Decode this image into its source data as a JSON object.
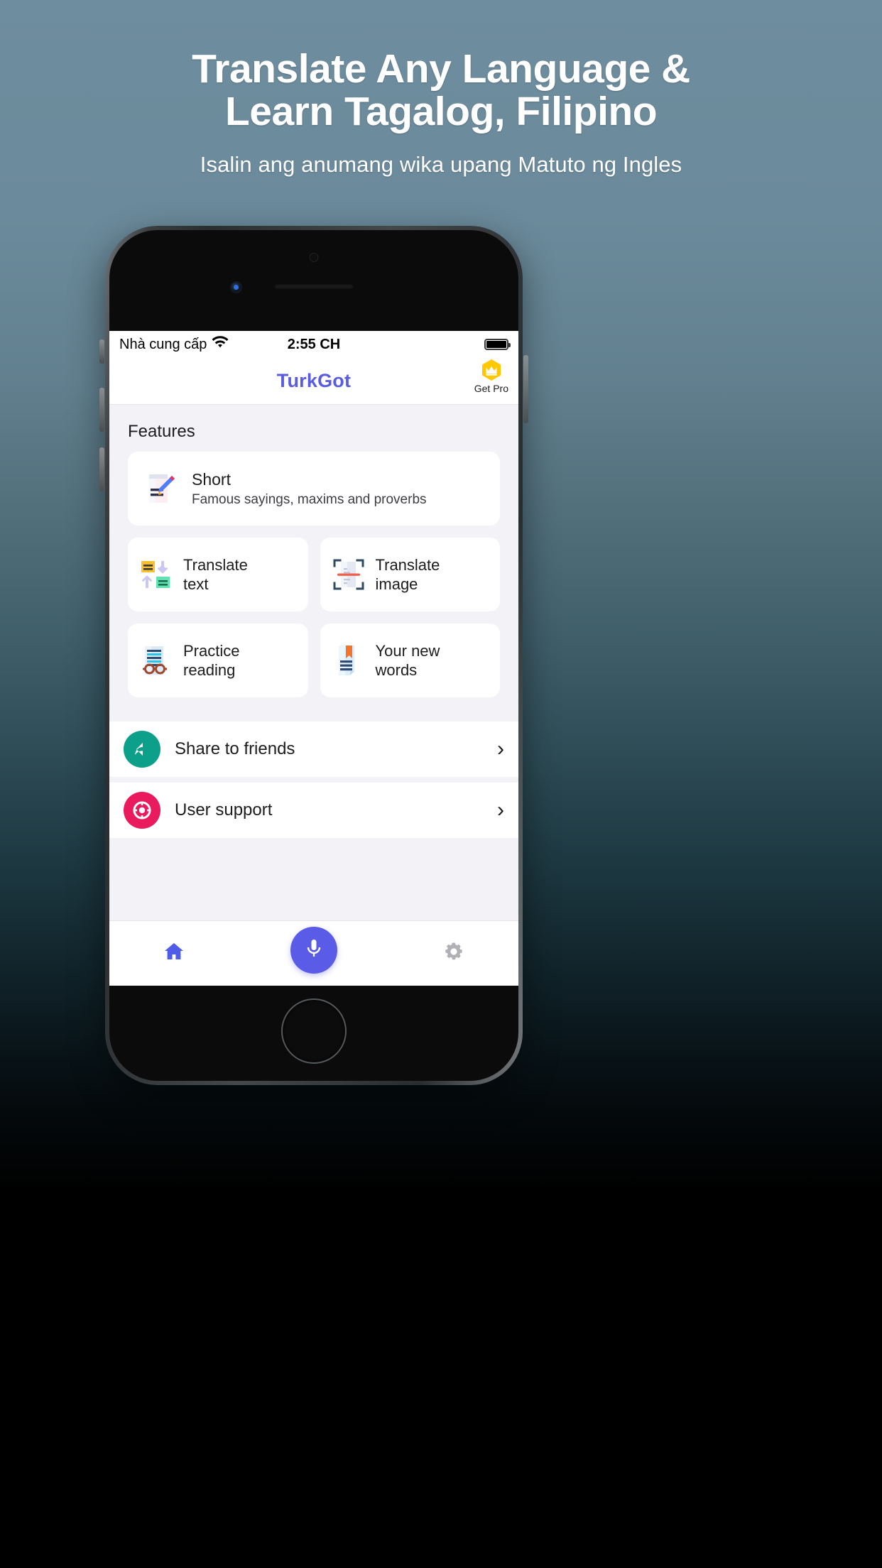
{
  "hero": {
    "title_line1": "Translate Any Language &",
    "title_line2": "Learn Tagalog, Filipino",
    "subtitle": "Isalin ang anumang wika upang Matuto ng Ingles",
    "text_color": "#ffffff",
    "bg_top_color": "#6e8d9e",
    "bg_bottom_color": "#000000"
  },
  "phone": {
    "status_bar": {
      "carrier": "Nhà cung cấp",
      "wifi_icon": "wifi-icon",
      "time": "2:55 CH",
      "battery_icon": "battery-full-icon"
    },
    "navbar": {
      "brand": "TurkGot",
      "brand_color": "#5a5ce0",
      "get_pro_label": "Get Pro",
      "get_pro_icon": "crown-hexagon-icon",
      "get_pro_color": "#ffc800"
    },
    "content": {
      "section_title": "Features",
      "featured_card": {
        "title": "Short",
        "subtitle": "Famous sayings, maxims and proverbs",
        "icon": "document-pencil-icon"
      },
      "grid_cards": [
        {
          "title_line1": "Translate",
          "title_line2": "text",
          "icon": "translate-text-icon"
        },
        {
          "title_line1": "Translate",
          "title_line2": "image",
          "icon": "scan-document-icon"
        },
        {
          "title_line1": "Practice",
          "title_line2": "reading",
          "icon": "reading-glasses-icon"
        },
        {
          "title_line1": "Your new",
          "title_line2": "words",
          "icon": "bookmark-document-icon"
        }
      ],
      "list_rows": [
        {
          "label": "Share to friends",
          "icon": "share-reply-icon",
          "color": "#0ca08a",
          "chevron": "›"
        },
        {
          "label": "User support",
          "icon": "life-ring-icon",
          "color": "#ea1a5e",
          "chevron": "›"
        }
      ]
    },
    "tabbar": {
      "items": [
        {
          "name": "home",
          "icon": "home-icon",
          "color": "#4f5ce8",
          "active": true
        },
        {
          "name": "mic",
          "icon": "microphone-icon",
          "color": "#5a5ce8",
          "active": false
        },
        {
          "name": "settings",
          "icon": "gear-icon",
          "color": "#b0b0b5",
          "active": false
        }
      ]
    }
  }
}
